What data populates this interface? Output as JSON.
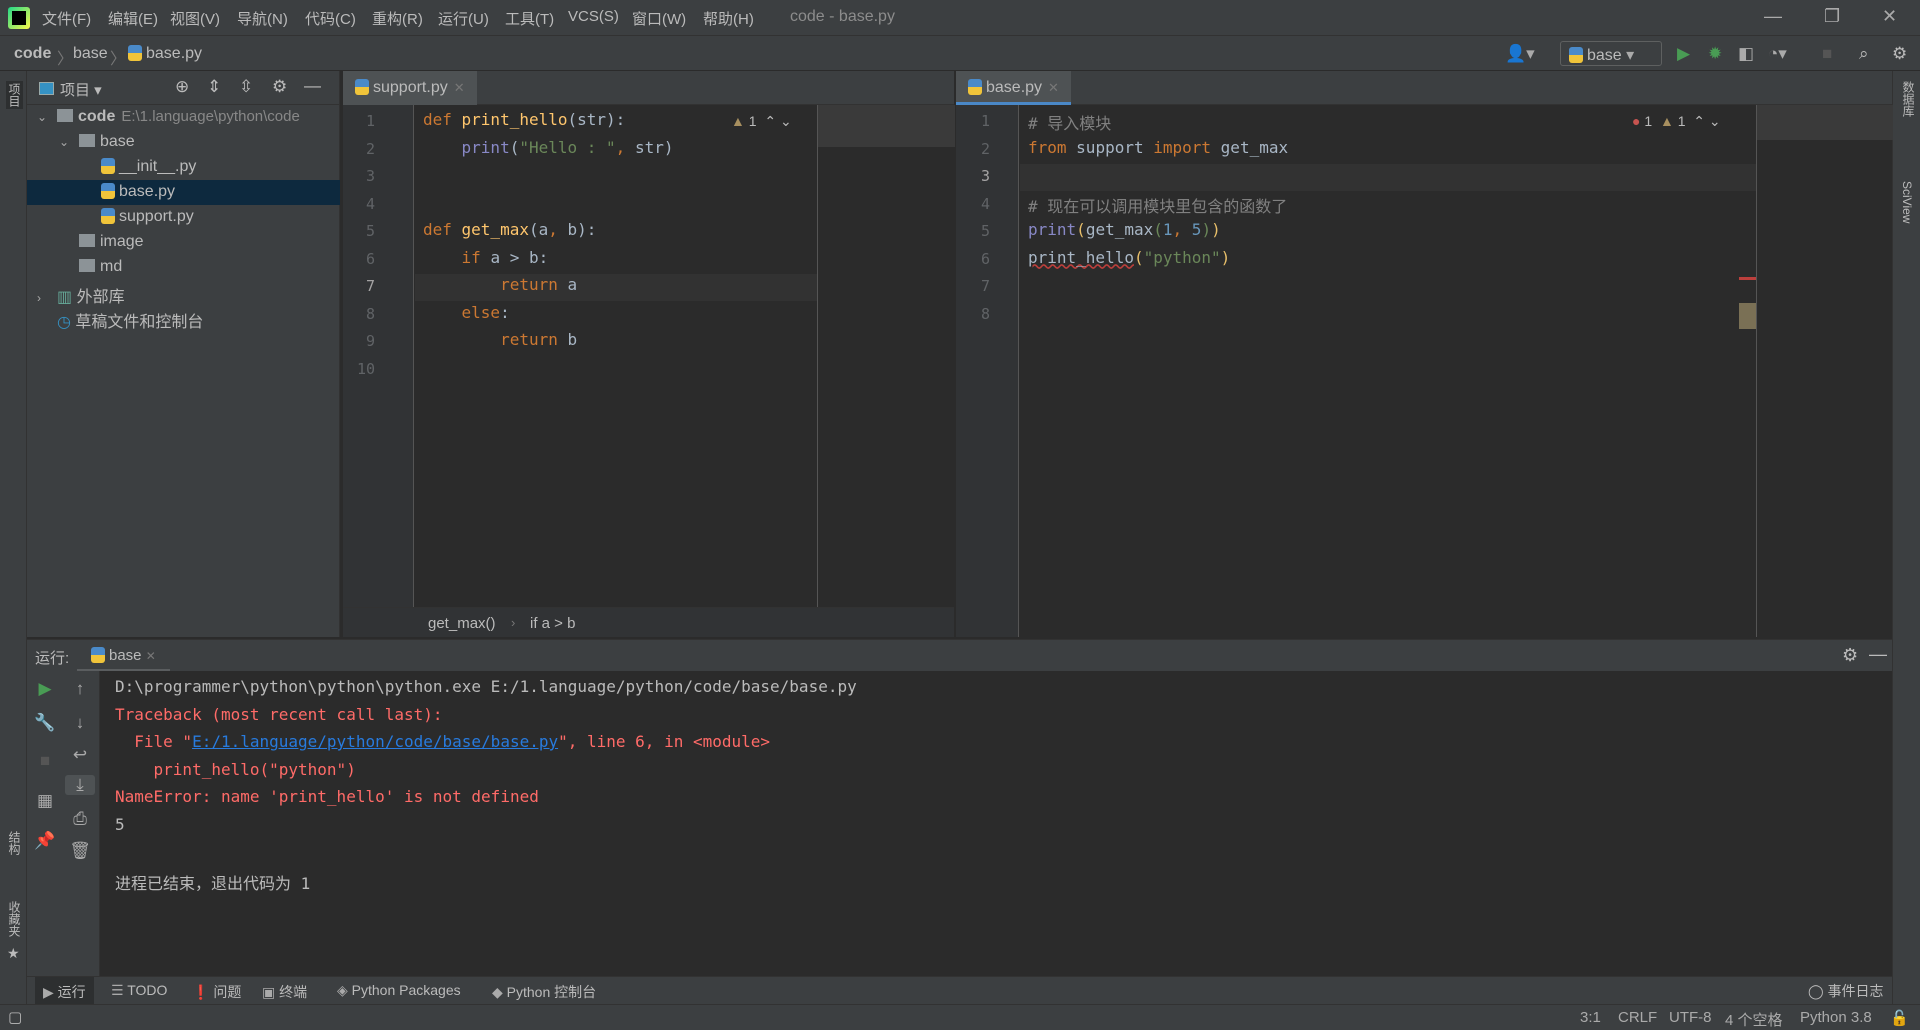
{
  "app": {
    "window_title": "code - base.py",
    "accent": "#4a88c7"
  },
  "menu": [
    "文件(F)",
    "编辑(E)",
    "视图(V)",
    "导航(N)",
    "代码(C)",
    "重构(R)",
    "运行(U)",
    "工具(T)",
    "VCS(S)",
    "窗口(W)",
    "帮助(H)"
  ],
  "breadcrumb": [
    "code",
    "base",
    "base.py"
  ],
  "toolbar": {
    "run_config": "base",
    "icons": [
      "user-icon",
      "run-icon",
      "debug-icon",
      "coverage-icon",
      "profile-icon",
      "stop-icon",
      "search-icon",
      "settings-icon"
    ]
  },
  "left_stripe": {
    "project": "项目",
    "structure": "结构",
    "favorites": "收藏夹"
  },
  "right_stripe": {
    "database": "数据库",
    "sciview": "SciView"
  },
  "project": {
    "title": "项目",
    "tree": [
      {
        "label": "code",
        "path": "E:\\1.language\\python\\code",
        "type": "folder",
        "depth": 0,
        "expanded": true
      },
      {
        "label": "base",
        "type": "package",
        "depth": 1,
        "expanded": true
      },
      {
        "label": "__init__.py",
        "type": "py",
        "depth": 2
      },
      {
        "label": "base.py",
        "type": "py",
        "depth": 2,
        "selected": true
      },
      {
        "label": "support.py",
        "type": "py",
        "depth": 2
      },
      {
        "label": "image",
        "type": "folder",
        "depth": 1
      },
      {
        "label": "md",
        "type": "folder",
        "depth": 1
      },
      {
        "label": "外部库",
        "type": "lib",
        "depth": 0,
        "expanded": false
      },
      {
        "label": "草稿文件和控制台",
        "type": "scratch",
        "depth": 0
      }
    ]
  },
  "editor_left": {
    "tab": "support.py",
    "warnings": "1",
    "current_line": 7,
    "lines": [
      [
        [
          "kw",
          "def "
        ],
        [
          "fn",
          "print_hello"
        ],
        [
          "pl",
          "("
        ],
        [
          "pl",
          "str"
        ],
        [
          "pl",
          "):"
        ]
      ],
      [
        [
          "pl",
          "    "
        ],
        [
          "bi",
          "print"
        ],
        [
          "pl",
          "("
        ],
        [
          "str",
          "\"Hello : \""
        ],
        [
          "kw",
          ", "
        ],
        [
          "pl",
          "str)"
        ]
      ],
      [],
      [],
      [
        [
          "kw",
          "def "
        ],
        [
          "fn",
          "get_max"
        ],
        [
          "pl",
          "(a"
        ],
        [
          "kw",
          ", "
        ],
        [
          "pl",
          "b):"
        ]
      ],
      [
        [
          "pl",
          "    "
        ],
        [
          "kw",
          "if "
        ],
        [
          "pl",
          "a > b:"
        ]
      ],
      [
        [
          "pl",
          "        "
        ],
        [
          "kw",
          "return "
        ],
        [
          "pl",
          "a"
        ]
      ],
      [
        [
          "pl",
          "    "
        ],
        [
          "kw",
          "else"
        ],
        [
          "pl",
          ":"
        ]
      ],
      [
        [
          "pl",
          "        "
        ],
        [
          "kw",
          "return "
        ],
        [
          "pl",
          "b"
        ]
      ],
      []
    ],
    "breadcrumb": [
      "get_max()",
      "if a > b"
    ]
  },
  "editor_right": {
    "tab": "base.py",
    "errors": "1",
    "warnings": "1",
    "current_line": 3,
    "lines": [
      [
        [
          "cm",
          "# 导入模块"
        ]
      ],
      [
        [
          "kw",
          "from "
        ],
        [
          "pl",
          "support "
        ],
        [
          "kw",
          "import "
        ],
        [
          "pl",
          "get_max"
        ]
      ],
      [],
      [
        [
          "cm",
          "# 现在可以调用模块里包含的函数了"
        ]
      ],
      [
        [
          "bi",
          "print"
        ],
        [
          "par",
          "("
        ],
        [
          "pl",
          "get_max"
        ],
        [
          "str",
          "("
        ],
        [
          "num",
          "1"
        ],
        [
          "kw",
          ", "
        ],
        [
          "num",
          "5"
        ],
        [
          "str",
          ")"
        ],
        [
          "par",
          ")"
        ]
      ],
      [
        [
          "err",
          "print_hello"
        ],
        [
          "par",
          "("
        ],
        [
          "str",
          "\"python\""
        ],
        [
          "par",
          ")"
        ]
      ],
      [],
      []
    ]
  },
  "run": {
    "label": "运行:",
    "tab": "base",
    "output": [
      {
        "style": "normal",
        "parts": [
          [
            "",
            "D:\\programmer\\python\\python\\python.exe E:/1.language/python/code/base/base.py"
          ]
        ]
      },
      {
        "style": "red",
        "parts": [
          [
            "",
            "Traceback (most recent call last):"
          ]
        ]
      },
      {
        "style": "red",
        "parts": [
          [
            "",
            "  File \""
          ],
          [
            "link",
            "E:/1.language/python/code/base/base.py"
          ],
          [
            "",
            "\", line 6, in <module>"
          ]
        ]
      },
      {
        "style": "red",
        "parts": [
          [
            "",
            "    print_hello(\"python\")"
          ]
        ]
      },
      {
        "style": "red",
        "parts": [
          [
            "",
            "NameError: name 'print_hello' is not defined"
          ]
        ]
      },
      {
        "style": "normal",
        "parts": [
          [
            "",
            "5"
          ]
        ]
      },
      {
        "style": "normal",
        "parts": [
          [
            "",
            ""
          ]
        ]
      },
      {
        "style": "normal",
        "parts": [
          [
            "",
            "进程已结束，退出代码为 1"
          ]
        ]
      }
    ]
  },
  "bottom_tabs": [
    "运行",
    "TODO",
    "问题",
    "终端",
    "Python Packages",
    "Python 控制台"
  ],
  "event_log": "事件日志",
  "status": {
    "position": "3:1",
    "line_sep": "CRLF",
    "encoding": "UTF-8",
    "indent": "4 个空格",
    "interpreter": "Python 3.8"
  }
}
